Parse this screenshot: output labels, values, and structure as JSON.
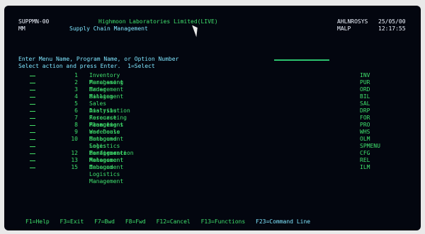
{
  "header": {
    "left_top": "SUPPMN-00",
    "left_sub": "MM",
    "title": "Highmoon Laboratories Limited(LIVE)",
    "subtitle": "Supply Chain Management",
    "right_top": "AHLNROSYS",
    "right_time_top": "25/05/00",
    "right_mid": "MALP",
    "right_time_mid": "12:17:55"
  },
  "prompt": {
    "line1": "Enter Menu Name, Program Name, or Option Number",
    "line2": "Select action and press Enter.  1=Select"
  },
  "menu": [
    {
      "option": "",
      "num": "1",
      "desc": "Inventory Management",
      "code": "INV"
    },
    {
      "option": "",
      "num": "2",
      "desc": "Purchasing Management",
      "code": "PUR"
    },
    {
      "option": "",
      "num": "3",
      "desc": "Order Management",
      "code": "ORD"
    },
    {
      "option": "",
      "num": "4",
      "desc": "Billing",
      "code": "BIL"
    },
    {
      "option": "",
      "num": "5",
      "desc": "Sales Analysis",
      "code": "SAL"
    },
    {
      "option": "",
      "num": "6",
      "desc": "Distribution Resource Planning",
      "code": "DRP"
    },
    {
      "option": "",
      "num": "7",
      "desc": "Forecasting Management",
      "code": "FOR"
    },
    {
      "option": "",
      "num": "8",
      "desc": "Promotions and Deals",
      "code": "PRO"
    },
    {
      "option": "",
      "num": "9",
      "desc": "Warehouse Management",
      "code": "WHS"
    },
    {
      "option": "",
      "num": "10",
      "desc": "Outbound Logistics Management",
      "code": "OLM"
    },
    {
      "option": "",
      "num": "",
      "desc": "Sales Performance Management",
      "code": "SPMENU"
    },
    {
      "option": "",
      "num": "12",
      "desc": "Configuration Management",
      "code": "CFG"
    },
    {
      "option": "",
      "num": "13",
      "desc": "Release Management",
      "code": "REL"
    },
    {
      "option": "",
      "num": "15",
      "desc": "Inbound Logistics Management",
      "code": "ILM"
    }
  ],
  "fkeys": {
    "f1": "F1=Help",
    "f3": "F3=Exit",
    "f7": "F7=Bwd",
    "f8": "F8=Fwd",
    "f12": "F12=Cancel",
    "f13": "F13=Functions",
    "f23": "F23=Command Line"
  }
}
